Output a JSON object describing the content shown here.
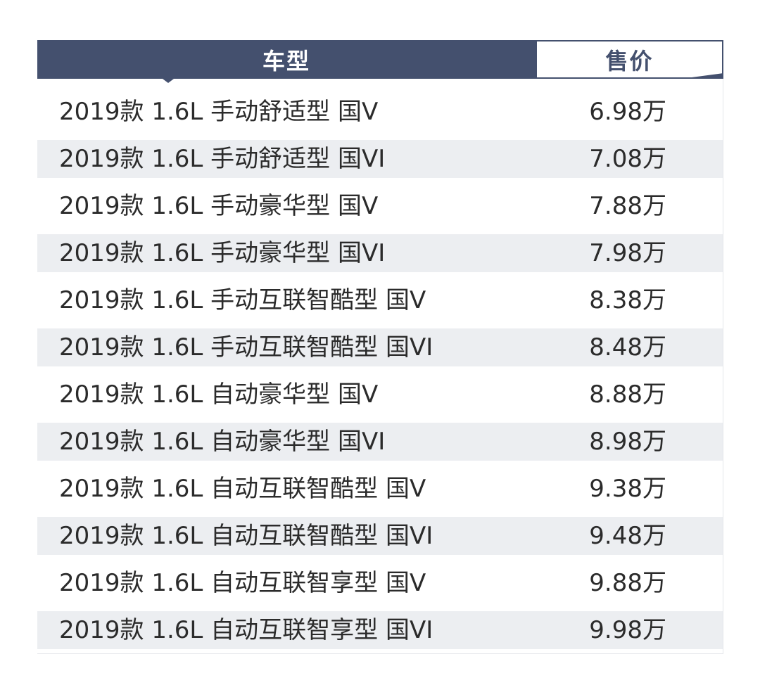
{
  "table": {
    "headers": {
      "model": "车型",
      "price": "售价"
    },
    "rows": [
      {
        "model": "2019款 1.6L 手动舒适型 国V",
        "price": "6.98万"
      },
      {
        "model": "2019款 1.6L 手动舒适型 国VI",
        "price": "7.08万"
      },
      {
        "model": "2019款 1.6L 手动豪华型 国V",
        "price": "7.88万"
      },
      {
        "model": "2019款 1.6L 手动豪华型 国VI",
        "price": "7.98万"
      },
      {
        "model": "2019款 1.6L 手动互联智酷型 国V",
        "price": "8.38万"
      },
      {
        "model": "2019款 1.6L 手动互联智酷型 国VI",
        "price": "8.48万"
      },
      {
        "model": "2019款 1.6L 自动豪华型 国V",
        "price": "8.88万"
      },
      {
        "model": "2019款 1.6L 自动豪华型 国VI",
        "price": "8.98万"
      },
      {
        "model": "2019款 1.6L 自动互联智酷型 国V",
        "price": "9.38万"
      },
      {
        "model": "2019款 1.6L 自动互联智酷型 国VI",
        "price": "9.48万"
      },
      {
        "model": "2019款 1.6L 自动互联智享型 国V",
        "price": "9.88万"
      },
      {
        "model": "2019款 1.6L 自动互联智享型 国VI",
        "price": "9.98万"
      }
    ]
  },
  "colors": {
    "header_bg": "#44506e",
    "stripe_bg": "#eceef1",
    "text": "#2b2b2b"
  }
}
